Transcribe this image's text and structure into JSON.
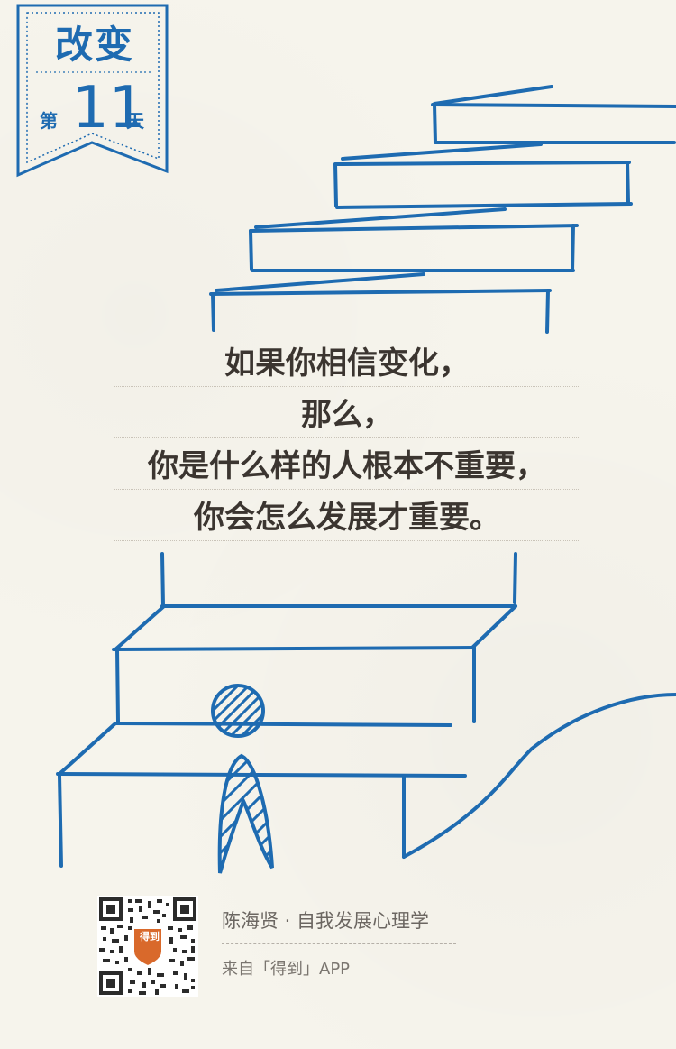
{
  "badge": {
    "title": "改变",
    "day_prefix": "第",
    "day_number": "11",
    "day_suffix": "天"
  },
  "quote": {
    "lines": [
      "如果你相信变化，",
      "那么，",
      "你是什么样的人根本不重要，",
      "你会怎么发展才重要。"
    ]
  },
  "footer": {
    "title": "陈海贤 · 自我发展心理学",
    "source": "来自「得到」APP",
    "qr_logo_text": "得到"
  },
  "colors": {
    "accent_blue": "#1e6bb1",
    "text_dark": "#3b3530",
    "background": "#f6f4ec",
    "logo_orange": "#d9692b"
  }
}
